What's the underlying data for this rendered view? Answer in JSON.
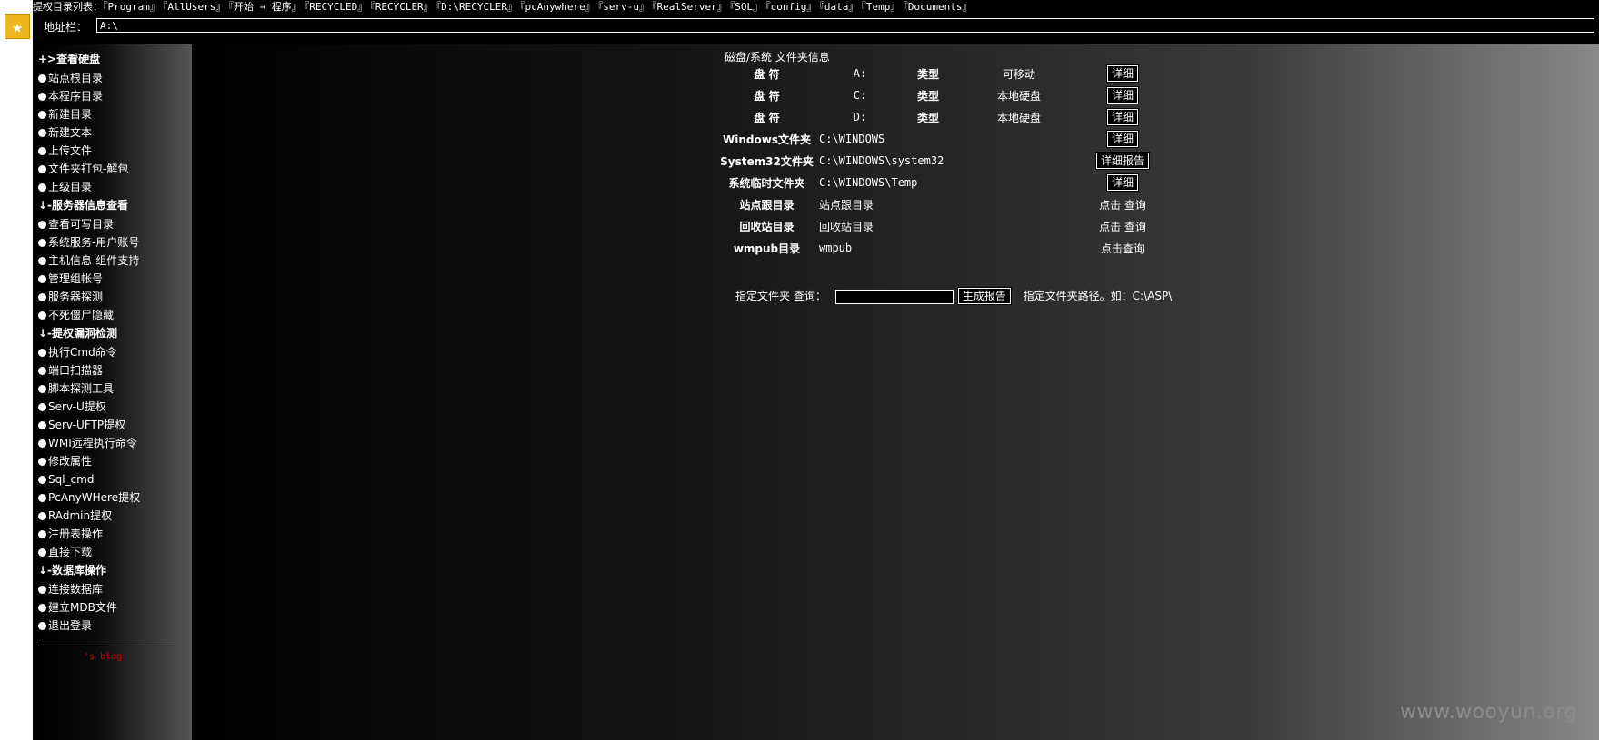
{
  "topbar": {
    "label": "提权目录列表：",
    "links": [
      "『Program』",
      "『AllUsers』",
      "『开始 → 程序』",
      "『RECYCLED』",
      "『RECYCLER』",
      "『D:\\RECYCLER』",
      "『pcAnywhere』",
      "『serv-u』",
      "『RealServer』",
      "『SQL』",
      "『config』",
      "『data』",
      "『Temp』",
      "『Documents』"
    ]
  },
  "address": {
    "label": "地址栏：",
    "value": "A:\\"
  },
  "sidebar": {
    "sections": [
      {
        "title": "+>查看硬盘",
        "items": [
          "站点根目录",
          "本程序目录",
          "新建目录",
          "新建文本",
          "上传文件",
          "文件夹打包-解包",
          "上级目录"
        ]
      },
      {
        "title": "↓-服务器信息查看",
        "items": [
          "查看可写目录",
          "系统服务-用户账号",
          "主机信息-组件支持",
          "管理组帐号",
          "服务器探测",
          "不死僵尸隐藏"
        ]
      },
      {
        "title": "↓-提权漏洞检测",
        "items": [
          "执行Cmd命令",
          "端口扫描器",
          "脚本探测工具",
          "Serv-U提权",
          "Serv-UFTP提权",
          "WMI远程执行命令",
          "修改属性",
          "Sql_cmd",
          "PcAnyWHere提权",
          "RAdmin提权",
          "注册表操作",
          "直接下载"
        ]
      },
      {
        "title": "↓-数据库操作",
        "items": [
          "连接数据库",
          "建立MDB文件",
          "退出登录"
        ]
      }
    ],
    "blog": "'s blog"
  },
  "main": {
    "title": "磁盘/系统 文件夹信息",
    "drives": [
      {
        "label": "盘 符",
        "letter": "A:",
        "type_label": "类型",
        "type": "可移动",
        "button": "详细"
      },
      {
        "label": "盘 符",
        "letter": "C:",
        "type_label": "类型",
        "type": "本地硬盘",
        "button": "详细"
      },
      {
        "label": "盘 符",
        "letter": "D:",
        "type_label": "类型",
        "type": "本地硬盘",
        "button": "详细"
      }
    ],
    "folders": [
      {
        "label": "Windows文件夹",
        "path": "C:\\WINDOWS",
        "button": "详细"
      },
      {
        "label": "System32文件夹",
        "path": "C:\\WINDOWS\\system32",
        "button": "详细报告"
      },
      {
        "label": "系统临时文件夹",
        "path": "C:\\WINDOWS\\Temp",
        "button": "详细"
      }
    ],
    "links": [
      {
        "label": "站点跟目录",
        "value": "站点跟目录",
        "action": "点击 查询"
      },
      {
        "label": "回收站目录",
        "value": "回收站目录",
        "action": "点击 查询"
      },
      {
        "label": "wmpub目录",
        "value": "wmpub",
        "action": "点击查询"
      }
    ],
    "query": {
      "label": "指定文件夹 查询：",
      "button": "生成报告",
      "hint": "指定文件夹路径。如：C:\\ASP\\"
    }
  },
  "watermark": "www.wooyun.org",
  "icons": {
    "favorite": "star-icon",
    "bullet": "bullet-icon"
  }
}
